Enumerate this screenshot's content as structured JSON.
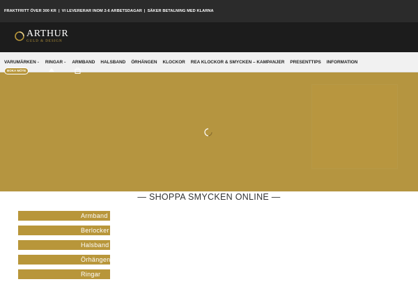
{
  "topbar": {
    "items": [
      "FRAKTFRITT ÖVER 300 KR",
      "VI LEVERERAR INOM 2-6 ARBETSDAGAR",
      "SÄKER BETALNING MED KLARNA"
    ],
    "separator": "|"
  },
  "logo": {
    "name": "ARTHUR",
    "tagline": "GULD & DESIGN",
    "brand_color": "#b8963a"
  },
  "nav": {
    "items": [
      {
        "label": "VARUMÄRKEN",
        "has_dropdown": true
      },
      {
        "label": "RINGAR",
        "has_dropdown": true
      },
      {
        "label": "ARMBAND",
        "has_dropdown": false
      },
      {
        "label": "HALSBAND",
        "has_dropdown": false
      },
      {
        "label": "ÖRHÄNGEN",
        "has_dropdown": false
      },
      {
        "label": "KLOCKOR",
        "has_dropdown": false
      },
      {
        "label": "REA KLOCKOR & SMYCKEN – KAMPANJER",
        "has_dropdown": false
      },
      {
        "label": "PRESENTTIPS",
        "has_dropdown": false
      },
      {
        "label": "INFORMATION",
        "has_dropdown": false
      }
    ],
    "book_button": "BOKA MÖTE",
    "chevron": "⌄"
  },
  "hero": {
    "background_color": "#b59540"
  },
  "section": {
    "title": "— SHOPPA SMYCKEN ONLINE —"
  },
  "categories": [
    "Armband",
    "Berlocker",
    "Halsband",
    "Örhängen",
    "Ringar"
  ],
  "colors": {
    "topbar": "#2b2b2b",
    "header": "#1c1c1c",
    "gold": "#b8963a"
  }
}
